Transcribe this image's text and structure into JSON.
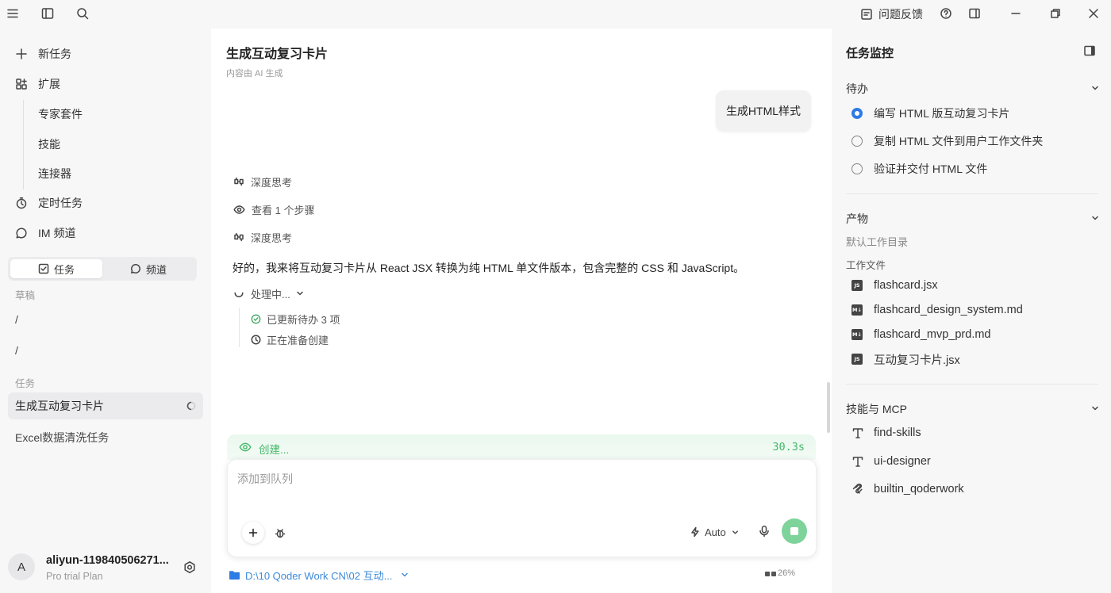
{
  "titlebar": {
    "feedback_label": "问题反馈"
  },
  "sidebar": {
    "new_task": "新任务",
    "extensions": "扩展",
    "ext_items": [
      "专家套件",
      "技能",
      "连接器"
    ],
    "scheduled": "定时任务",
    "im_channel": "IM 频道",
    "tab_tasks": "任务",
    "tab_channels": "频道",
    "drafts_label": "草稿",
    "drafts": [
      "/",
      "/"
    ],
    "tasks_label": "任务",
    "tasks": [
      "生成互动复习卡片",
      "Excel数据清洗任务"
    ],
    "user": {
      "avatar_letter": "A",
      "name": "aliyun-119840506271...",
      "plan": "Pro trial Plan"
    }
  },
  "main": {
    "title": "生成互动复习卡片",
    "subtitle": "内容由 AI 生成",
    "user_message": "生成HTML样式",
    "steps": [
      "深度思考",
      "查看 1 个步骤",
      "深度思考"
    ],
    "reply": "好的，我来将互动复习卡片从 React JSX 转换为纯 HTML 单文件版本，包含完整的 CSS 和 JavaScript。",
    "processing": "处理中...",
    "sub_steps": [
      "已更新待办  3 项",
      "正在准备创建"
    ],
    "status_text": "创建...",
    "status_time": "30.3s",
    "composer_placeholder": "添加到队列",
    "mode_label": "Auto",
    "path": "D:\\10 Qoder Work CN\\02 互动...",
    "context_pct": "26%"
  },
  "right_panel": {
    "title": "任务监控",
    "todo_label": "待办",
    "todos": [
      {
        "label": "编写 HTML 版互动复习卡片",
        "state": "in-progress"
      },
      {
        "label": "复制 HTML 文件到用户工作文件夹",
        "state": "pending"
      },
      {
        "label": "验证并交付 HTML 文件",
        "state": "pending"
      }
    ],
    "artifacts_label": "产物",
    "default_dir": "默认工作目录",
    "work_files_label": "工作文件",
    "files": [
      {
        "name": "flashcard.jsx",
        "tag": "JS"
      },
      {
        "name": "flashcard_design_system.md",
        "tag": "M↓"
      },
      {
        "name": "flashcard_mvp_prd.md",
        "tag": "M↓"
      },
      {
        "name": "互动复习卡片.jsx",
        "tag": "JS"
      }
    ],
    "skills_label": "技能与 MCP",
    "skills": [
      "find-skills",
      "ui-designer",
      "builtin_qoderwork"
    ]
  },
  "colors": {
    "accent_blue": "#2d7be5",
    "status_green": "#46b86a",
    "stop_button": "#7ed39b"
  }
}
